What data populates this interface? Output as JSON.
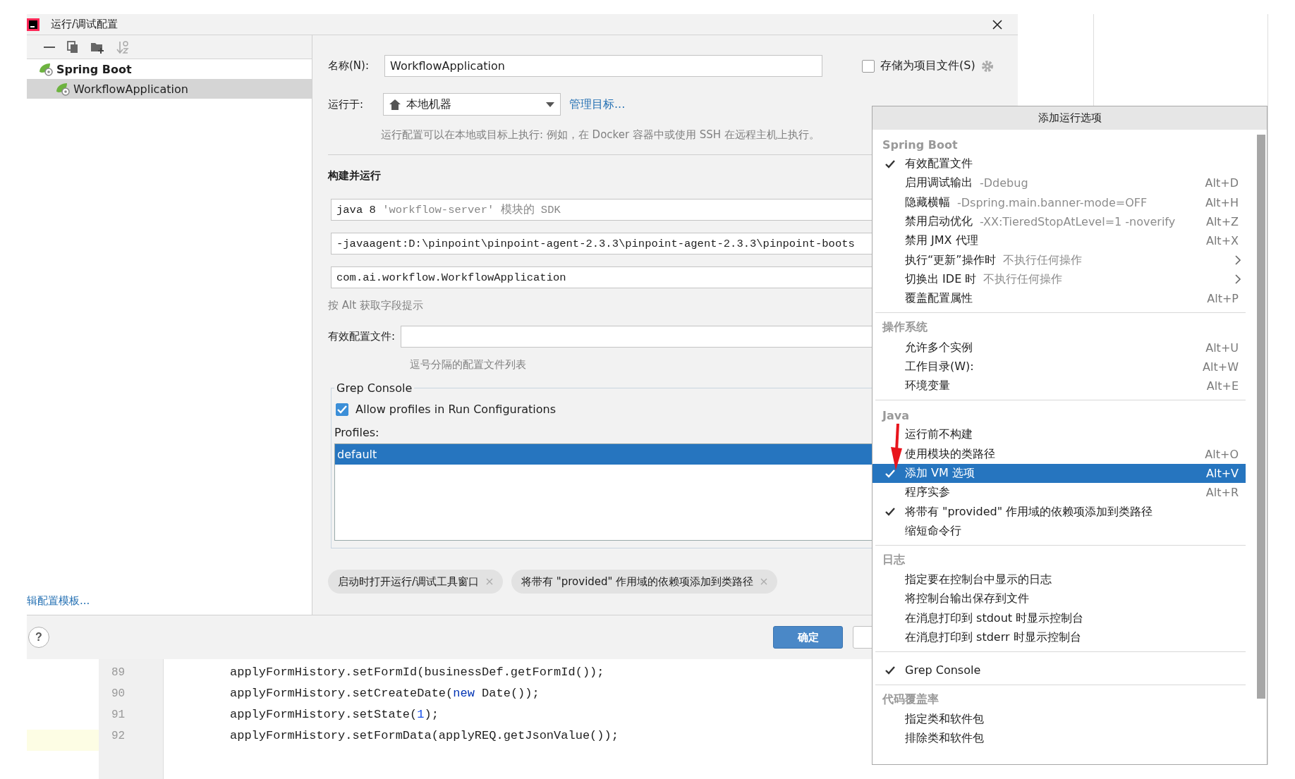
{
  "window": {
    "title": "运行/调试配置"
  },
  "tree": [
    {
      "label": "Spring Boot",
      "selected": false,
      "children": [
        {
          "label": "WorkflowApplication",
          "selected": true
        }
      ]
    }
  ],
  "edit_templates_link": "辑配置模板...",
  "form": {
    "name": {
      "label": "名称(N):",
      "value": "WorkflowApplication"
    },
    "store_as_file": {
      "label": "存储为项目文件(S)",
      "checked": false
    },
    "run_on": {
      "label": "运行于:",
      "value": "本地机器",
      "link": "管理目标..."
    },
    "run_on_hint": "运行配置可以在本地或目标上执行: 例如，在 Docker 容器中或使用 SSH 在远程主机上执行。",
    "build_title": "构建并运行",
    "build_fields": [
      {
        "value": "java 8",
        "hint": "'workflow-server' 模块的 SDK"
      },
      {
        "value": "-javaagent:D:\\pinpoint\\pinpoint-agent-2.3.3\\pinpoint-agent-2.3.3\\pinpoint-boots"
      },
      {
        "value": "com.ai.workflow.WorkflowApplication"
      }
    ],
    "field_hint": "按 Alt 获取字段提示",
    "profiles_field": {
      "label": "有效配置文件:",
      "hint": "逗号分隔的配置文件列表"
    },
    "grep_console": {
      "title": "Grep Console",
      "allow_profiles": {
        "label": "Allow profiles in Run Configurations",
        "checked": true
      },
      "profiles_label": "Profiles:",
      "profiles": [
        {
          "label": "default",
          "selected": true
        }
      ]
    },
    "chips": [
      {
        "label": "启动时打开运行/调试工具窗口"
      },
      {
        "label": "将带有 \"provided\" 作用域的依赖项添加到类路径"
      }
    ]
  },
  "footer": {
    "help": "?",
    "ok": "确定"
  },
  "editor": {
    "lines": [
      {
        "number": "89",
        "segments": [
          {
            "kind": "plain",
            "text": "applyFormHistory.setFormId(businessDef.getFormId());"
          }
        ]
      },
      {
        "number": "90",
        "segments": [
          {
            "kind": "plain",
            "text": "applyFormHistory.setCreateDate("
          },
          {
            "kind": "keyword",
            "text": "new"
          },
          {
            "kind": "plain",
            "text": " Date());"
          }
        ]
      },
      {
        "number": "91",
        "segments": [
          {
            "kind": "plain",
            "text": "applyFormHistory.setState("
          },
          {
            "kind": "number",
            "text": "1"
          },
          {
            "kind": "plain",
            "text": ");"
          }
        ]
      },
      {
        "number": "92",
        "segments": [
          {
            "kind": "plain",
            "text": "applyFormHistory.setFormData(applyREQ.getJsonValue());"
          }
        ]
      }
    ]
  },
  "menu": {
    "title": "添加运行选项",
    "sections": [
      {
        "header": "Spring Boot",
        "items": [
          {
            "label": "有效配置文件",
            "checked": true,
            "selected": false,
            "kind": "action"
          },
          {
            "label": "启用调试输出",
            "hint": "-Ddebug",
            "shortcut": "Alt+D",
            "checked": false,
            "selected": false,
            "kind": "action"
          },
          {
            "label": "隐藏横幅",
            "hint": "-Dspring.main.banner-mode=OFF",
            "shortcut": "Alt+H",
            "checked": false,
            "selected": false,
            "kind": "action"
          },
          {
            "label": "禁用启动优化",
            "hint": "-XX:TieredStopAtLevel=1 -noverify",
            "shortcut": "Alt+Z",
            "checked": false,
            "selected": false,
            "kind": "action"
          },
          {
            "label": "禁用 JMX 代理",
            "shortcut": "Alt+X",
            "checked": false,
            "selected": false,
            "kind": "action"
          },
          {
            "label": "执行“更新”操作时",
            "hint": "不执行任何操作",
            "checked": false,
            "selected": false,
            "kind": "submenu"
          },
          {
            "label": "切换出 IDE 时",
            "hint": "不执行任何操作",
            "checked": false,
            "selected": false,
            "kind": "submenu"
          },
          {
            "label": "覆盖配置属性",
            "shortcut": "Alt+P",
            "checked": false,
            "selected": false,
            "kind": "action"
          }
        ]
      },
      {
        "header": "操作系统",
        "items": [
          {
            "label": "允许多个实例",
            "shortcut": "Alt+U",
            "checked": false,
            "selected": false,
            "kind": "action"
          },
          {
            "label": "工作目录(W):",
            "shortcut": "Alt+W",
            "checked": false,
            "selected": false,
            "kind": "action"
          },
          {
            "label": "环境变量",
            "shortcut": "Alt+E",
            "checked": false,
            "selected": false,
            "kind": "action"
          }
        ]
      },
      {
        "header": "Java",
        "items": [
          {
            "label": "运行前不构建",
            "checked": false,
            "selected": false,
            "kind": "action"
          },
          {
            "label": "使用模块的类路径",
            "shortcut": "Alt+O",
            "checked": false,
            "selected": false,
            "kind": "action"
          },
          {
            "label": "添加 VM 选项",
            "shortcut": "Alt+V",
            "checked": true,
            "selected": true,
            "kind": "action"
          },
          {
            "label": "程序实参",
            "shortcut": "Alt+R",
            "checked": false,
            "selected": false,
            "kind": "action"
          },
          {
            "label": "将带有 \"provided\" 作用域的依赖项添加到类路径",
            "checked": true,
            "selected": false,
            "kind": "action"
          },
          {
            "label": "缩短命令行",
            "checked": false,
            "selected": false,
            "kind": "action"
          }
        ]
      },
      {
        "header": "日志",
        "items": [
          {
            "label": "指定要在控制台中显示的日志",
            "checked": false,
            "selected": false,
            "kind": "action"
          },
          {
            "label": "将控制台输出保存到文件",
            "checked": false,
            "selected": false,
            "kind": "action"
          },
          {
            "label": "在消息打印到 stdout 时显示控制台",
            "checked": false,
            "selected": false,
            "kind": "action"
          },
          {
            "label": "在消息打印到 stderr 时显示控制台",
            "checked": false,
            "selected": false,
            "kind": "action"
          }
        ]
      },
      {
        "items": [
          {
            "label": "Grep Console",
            "checked": true,
            "selected": false,
            "kind": "action"
          }
        ]
      },
      {
        "header": "代码覆盖率",
        "items": [
          {
            "label": "指定类和软件包",
            "checked": false,
            "selected": false,
            "kind": "action"
          },
          {
            "label": "排除类和软件包",
            "checked": false,
            "selected": false,
            "kind": "action"
          }
        ]
      }
    ]
  }
}
